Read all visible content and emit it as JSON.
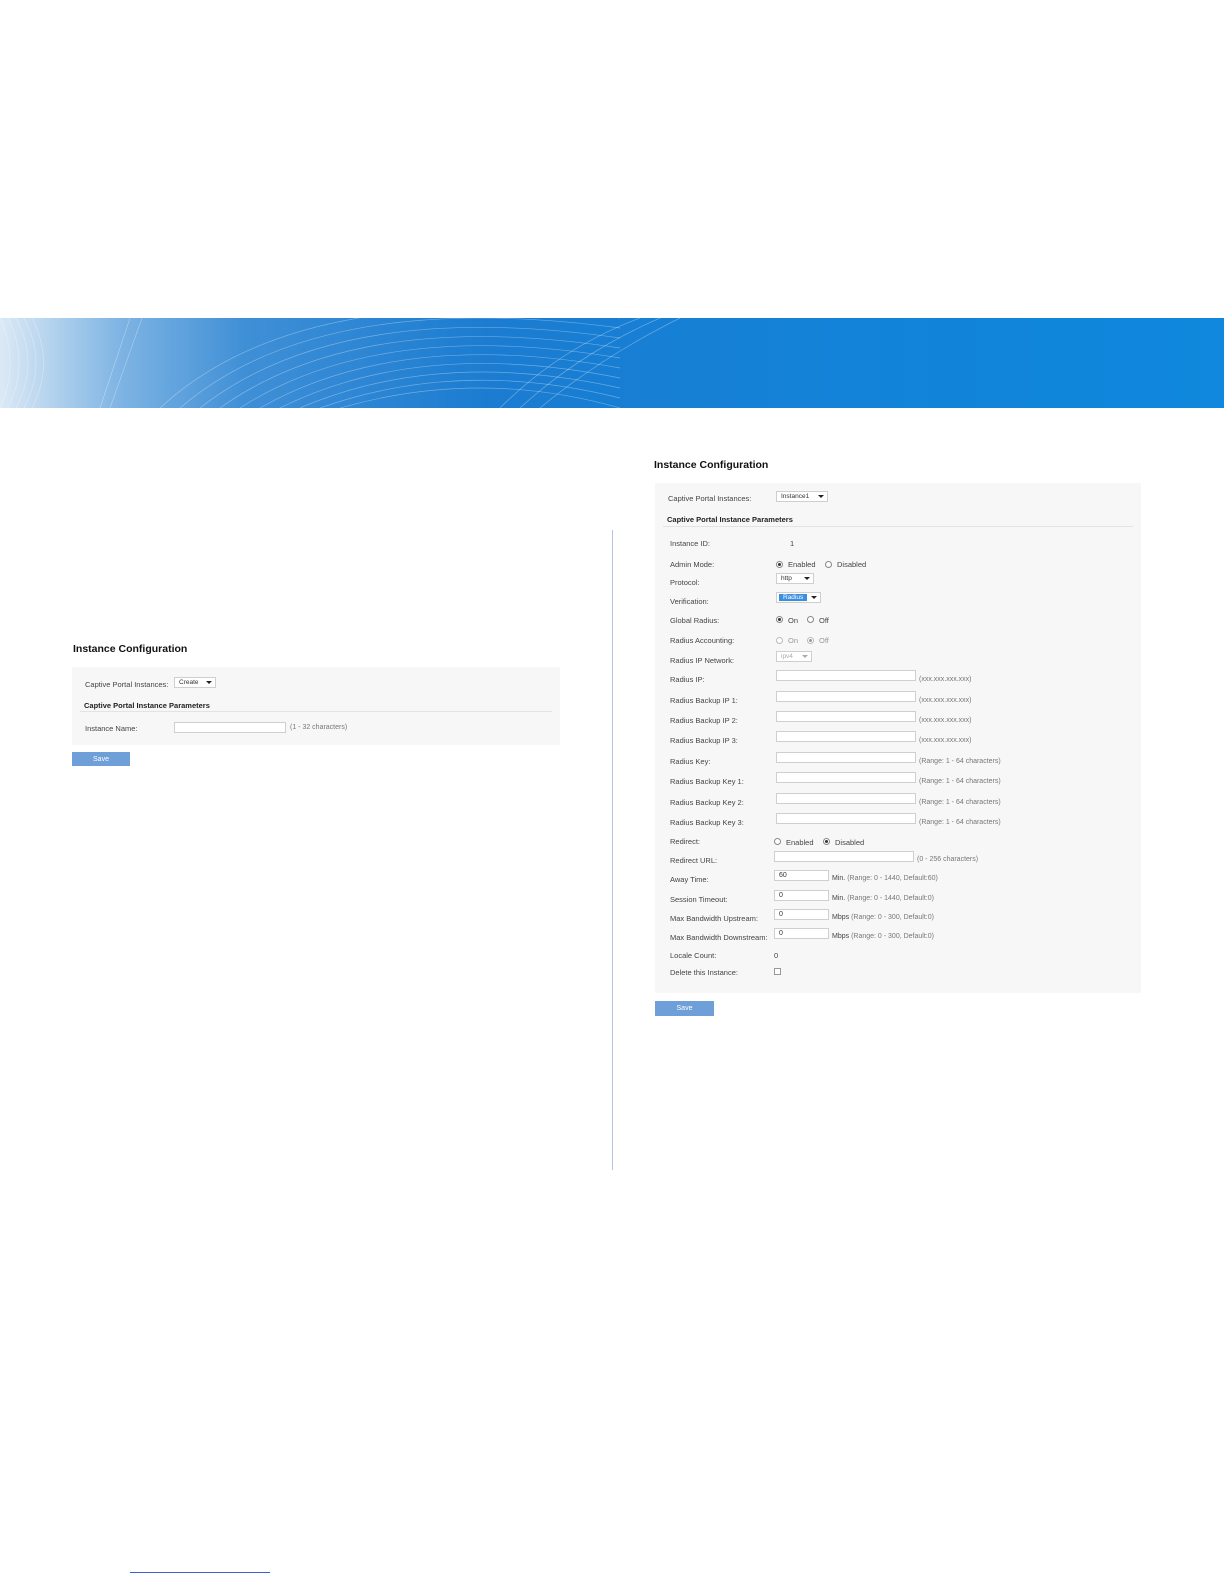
{
  "left": {
    "title": "Instance Configuration",
    "captive_portal_label": "Captive Portal Instances:",
    "captive_portal_value": "Create",
    "params_heading": "Captive Portal Instance Parameters",
    "instance_name_label": "Instance Name:",
    "instance_name_value": "",
    "instance_name_hint": "(1 - 32 characters)",
    "save_label": "Save"
  },
  "right": {
    "title": "Instance Configuration",
    "captive_portal_label": "Captive Portal Instances:",
    "captive_portal_value": "Instance1",
    "params_heading": "Captive Portal Instance Parameters",
    "instance_id_label": "Instance ID:",
    "instance_id_value": "1",
    "admin_mode_label": "Admin Mode:",
    "admin_mode_enabled": "Enabled",
    "admin_mode_disabled": "Disabled",
    "admin_mode_selected": "Enabled",
    "protocol_label": "Protocol:",
    "protocol_value": "http",
    "verification_label": "Verification:",
    "verification_value": "Radius",
    "global_radius_label": "Global Radius:",
    "global_radius_on": "On",
    "global_radius_off": "Off",
    "global_radius_selected": "On",
    "radius_accounting_label": "Radius Accounting:",
    "radius_accounting_on": "On",
    "radius_accounting_off": "Off",
    "radius_accounting_selected": "Off",
    "radius_ip_network_label": "Radius IP Network:",
    "radius_ip_network_value": "ipv4",
    "radius_ip_label": "Radius IP:",
    "radius_backup_ip1_label": "Radius Backup IP 1:",
    "radius_backup_ip2_label": "Radius Backup IP 2:",
    "radius_backup_ip3_label": "Radius Backup IP 3:",
    "ip_hint": "(xxx.xxx.xxx.xxx)",
    "radius_key_label": "Radius Key:",
    "radius_backup_key1_label": "Radius Backup Key 1:",
    "radius_backup_key2_label": "Radius Backup Key 2:",
    "radius_backup_key3_label": "Radius Backup Key 3:",
    "key_hint": "(Range: 1 - 64 characters)",
    "redirect_label": "Redirect:",
    "redirect_enabled": "Enabled",
    "redirect_disabled": "Disabled",
    "redirect_selected": "Disabled",
    "redirect_url_label": "Redirect URL:",
    "redirect_url_hint": "(0 - 256 characters)",
    "away_time_label": "Away Time:",
    "away_time_value": "60",
    "away_time_unit": "Min.",
    "away_time_hint": "(Range: 0 - 1440, Default:60)",
    "session_timeout_label": "Session Timeout:",
    "session_timeout_value": "0",
    "session_timeout_unit": "Min.",
    "session_timeout_hint": "(Range: 0 - 1440, Default:0)",
    "max_up_label": "Max Bandwidth Upstream:",
    "max_up_value": "0",
    "max_up_unit": "Mbps",
    "max_up_hint": "(Range: 0 - 300, Default:0)",
    "max_down_label": "Max Bandwidth Downstream:",
    "max_down_value": "0",
    "max_down_unit": "Mbps",
    "max_down_hint": "(Range: 0 - 300, Default:0)",
    "locale_count_label": "Locale Count:",
    "locale_count_value": "0",
    "delete_label": "Delete this Instance:",
    "save_label": "Save"
  }
}
